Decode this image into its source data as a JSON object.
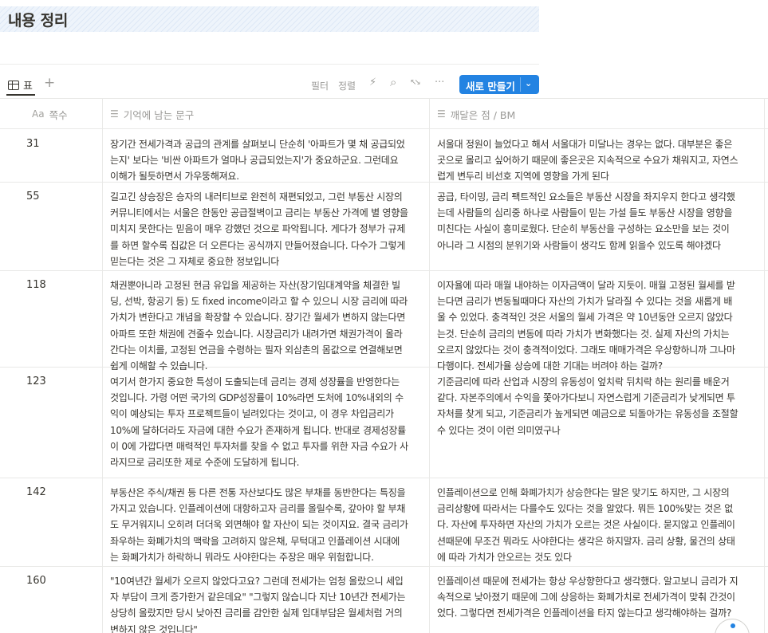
{
  "page": {
    "title": "내용 정리"
  },
  "toolbar": {
    "view_tab_label": "표",
    "add_view": "+",
    "filter": "필터",
    "sort": "정렬",
    "bolt": "⚡",
    "search": "⌕",
    "expand": "↖↘",
    "more": "···",
    "new_label": "새로 만들기",
    "new_chevron": "⌄"
  },
  "table": {
    "headers": {
      "pages": {
        "icon": "Aa",
        "label": "쪽수"
      },
      "memorable": {
        "icon": "☰",
        "label": "기억에 남는 문구"
      },
      "insight": {
        "icon": "☰",
        "label": "깨달은 점 / BM"
      }
    },
    "rows": [
      {
        "page": "31",
        "a": [
          "장기간 전세가격과 공급의 관계를 살펴보니 단순히 '아파트가 몇 채 공급되었",
          "는지' 보다는 '비싼 아파트가 얼마나 공급되었는지'가 중요하군요. 그런데요",
          "이해가 될듯하면서 가우뚱해져요."
        ],
        "b": [
          "서울대 정원이 늘었다고 해서 서울대가 미달나는 경우는 없다. 대부분은 좋은",
          "곳으로 몰리고 싶어하기 때문에 좋은곳은 지속적으로 수요가 채워지고, 자연스",
          "럽게 변두리 비선호 지역에 영향을 가게 된다"
        ]
      },
      {
        "page": "55",
        "a": [
          "길고긴 상승장은 승자의 내러티브로 완전히 재편되었고, 그런 부동산 시장의",
          "커뮤니티에서는 서울은 한동안 공급절벽이고 금리는 부동산 가격에 별 영향을",
          "미치지 못한다는 믿음이 매우 강했던 것으로 파악됩니다. 게다가 정부가 규제",
          "를 하면 할수록 집값은 더 오른다는 공식까지 만들어졌습니다. 다수가 그렇게",
          "믿는다는 것은 그 자체로 중요한 정보입니다"
        ],
        "b": [
          "공급, 타이밍, 금리 팩트적인 요소들은 부동산 시장을 좌지우지 한다고 생각했",
          "는데 사람들의 심리중 하나로 사람들이 믿는 가설 들도 부동산 시장을 영향을",
          "미친다는 사실이 흥미로웠다. 단순히 부동산을 구성하는 요소만을 보는 것이",
          "아니라 그 시점의 분위기와 사람들이 생각도 함께 읽을수 있도록 해야겠다"
        ]
      },
      {
        "page": "118",
        "a": [
          "채권뿐아니라 고정된 현금 유입을 제공하는 자산(장기임대계약을 체결한 빌",
          "딩, 선박, 항공기 등) 도 fixed income이라고 할 수 있으니 시장 금리에 따라",
          "가치가 변한다고 개념을 확장할 수 있습니다. 장기간 월세가 변하지 않는다면",
          "아파트 또한 채권에 견줄수 있습니다. 시장금리가 내려가면 채권가격이 올라",
          "간다는 이치를, 고정된 연금을 수령하는 필자 외삼촌의 몸값으로 연결해보면",
          "쉽게 이해할 수 있습니다."
        ],
        "b": [
          "이자율에 따라 매월 내야하는 이자금액이 달라 지듯이. 매월 고정된 월세를 받",
          "는다면 금리가 변동될때마다 자산의 가치가 달라질 수 있다는 것을 새롭게 배",
          "울 수 있었다. 충격적인 것은 서울의 월세 가격은 약 10년동안 오르지 않았다",
          "는것. 단순히 금리의 변동에 따라 가치가 변화했다는 것. 실제 자산의 가치는",
          "오르지 않았다는 것이 충격적이었다. 그래도 매매가격은 우상향하니까 그나마",
          "다행이다. 전세가율 상승에 대한 기대는 버려야 하는 걸까?"
        ]
      },
      {
        "page": "123",
        "a": [
          "여기서 한가지 중요한 특성이 도출되는데 금리는 경제 성장률을 반영한다는",
          "것입니다. 가령 어떤 국가의 GDP성장률이 10%라면 도처에 10%내외의 수",
          "익이 예상되는 투자 프로젝트들이 널려있다는 것이고, 이 경우 차입금리가",
          "10%에 달하더라도 자금에 대한 수요가 존재하게 됩니다. 반대로 경제성장률",
          "이 0에 가깝다면 매력적인 투자처를 찾을 수 없고 투자를 위한 자금 수요가 사",
          "라지므로 금리또한 제로 수준에 도달하게 됩니다."
        ],
        "b": [
          "기준금리에 따라 산업과 시장의 유동성이 엎치락 뒤치락 하는 원리를 배운거",
          "같다. 자본주의에서 수익을 쫓아가다보니 자연스럽게 기준금리가 낮게되면 투",
          "자처를 찾게 되고, 기준금리가 높게되면 예금으로 되돌아가는 유동성을 조절할",
          "수 있다는 것이 이런 의미였구나"
        ]
      },
      {
        "page": "142",
        "a": [
          "부동산은 주식/채권 등 다른 전통 자산보다도 많은 부채를 동반한다는 특징을",
          "가지고 있습니다. 인플레이션에 대항하고자 금리를 올릴수록, 갚아야 할 부채",
          "도 무거워지니 오히려 더더욱 외면해야 할 자산이 되는 것이지요. 결국 금리가",
          "좌우하는 화폐가치의 맥락을 고려하지 않은채, 무턱대고 인플레이션 시대에",
          "는 화폐가치가 하락하니 뭐라도 사야한다는 주장은 매우 위험합니다."
        ],
        "b": [
          "인플레이션으로 인해 화폐가치가 상승한다는 말은 맞기도 하지만, 그 시장의",
          "금리상황에 따라서는 다를수도 있다는 것을 알았다. 뭐든 100%맞는 것은 없",
          "다. 자산에 투자하면 자산의 가치가 오르는 것은 사실이다. 묻지않고 인플레이",
          "션때문에 무조건 뭐라도 사야한다는 생각은 하지말자. 금리 상황, 물건의 상태",
          "에 따라 가치가 안오르는 것도 있다"
        ]
      },
      {
        "page": "160",
        "a": [
          "\"10여년간 월세가 오르지 않았다고요? 그런데 전세가는 엄청 올랐으니 세입",
          "자 부담이 크게 증가한거 같은데요\" \"그렇지 않습니다 지난 10년간 전세가는",
          "상당히 올랐지만 당시 낮아진 금리를 감안한 실제 임대부담은 월세처럼 거의",
          "변하지 않은 것입니다\""
        ],
        "b": [
          "인플레이션 때문에 전세가는 항상 우상향한다고 생각했다. 알고보니 금리가 지",
          "속적으로 낮아졌기 때문에 그에 상응하는 화폐가치로 전세가격이 맞춰 간것이",
          "었다. 그렇다면 전세가격은 인플레이션을 타지 않는다고 생각해야하는 걸까?"
        ]
      }
    ]
  }
}
